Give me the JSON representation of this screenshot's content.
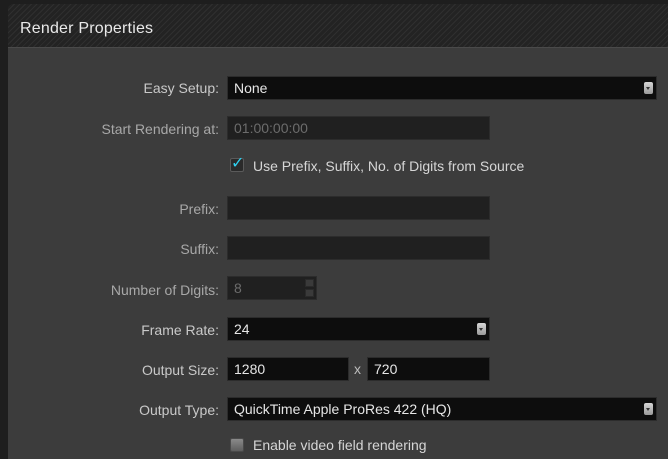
{
  "header": {
    "title": "Render Properties"
  },
  "easy_setup": {
    "label": "Easy Setup:",
    "value": "None"
  },
  "start_rendering": {
    "label": "Start Rendering at:",
    "value": "01:00:00:00"
  },
  "use_prefix": {
    "label": "Use Prefix, Suffix, No. of Digits from Source",
    "checked": true
  },
  "prefix": {
    "label": "Prefix:",
    "value": ""
  },
  "suffix": {
    "label": "Suffix:",
    "value": ""
  },
  "number_of_digits": {
    "label": "Number of Digits:",
    "value": "8"
  },
  "frame_rate": {
    "label": "Frame Rate:",
    "value": "24"
  },
  "output_size": {
    "label": "Output Size:",
    "width": "1280",
    "separator": "x",
    "height": "720"
  },
  "output_type": {
    "label": "Output Type:",
    "value": "QuickTime Apple ProRes 422 (HQ)"
  },
  "field_rendering": {
    "label": "Enable video field rendering",
    "checked": false
  },
  "colors": {
    "accent": "#2fd0f0",
    "panel": "#3c3c3c",
    "field": "#0d0d0d"
  }
}
